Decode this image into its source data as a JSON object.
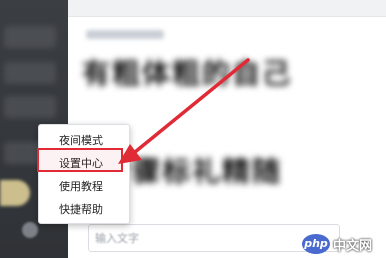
{
  "context_menu": {
    "items": [
      "夜间模式",
      "设置中心",
      "使用教程",
      "快捷帮助"
    ],
    "highlighted": "设置中心"
  },
  "chat": {
    "blurred_line_1": "有粗体粗的自己",
    "blurred_line_2": "步骤标礼精随"
  },
  "input": {
    "placeholder": "输入文字"
  },
  "watermark": {
    "logo_text": "php",
    "site_text": "中文网"
  },
  "colors": {
    "sidebar": "#34373b",
    "highlight": "#e02a36",
    "arrow": "#e02a36"
  },
  "icons": [
    "settings-gear-icon",
    "arrow-annotation"
  ]
}
